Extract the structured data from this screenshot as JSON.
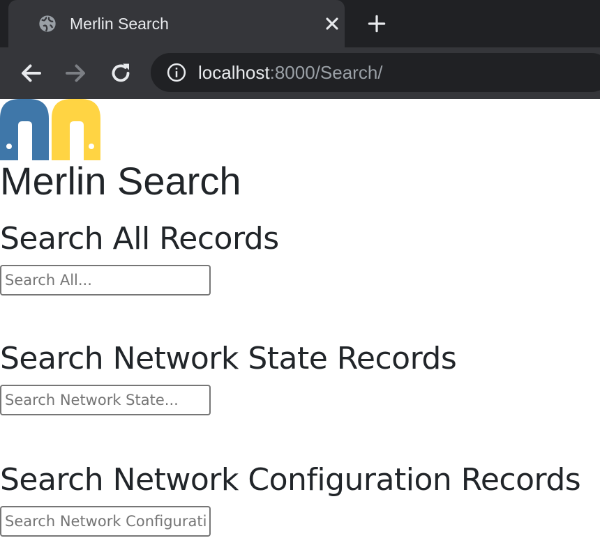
{
  "browser": {
    "tab": {
      "title": "Merlin Search",
      "icon": "globe-icon"
    },
    "new_tab_icon": "plus-icon",
    "address_bar": {
      "host": "localhost",
      "path": ":8000/Search/",
      "info_icon": "info-icon"
    }
  },
  "page": {
    "logo": "merlin-logo",
    "title": "Merlin Search",
    "sections": [
      {
        "heading": "Search All Records",
        "placeholder": "Search All..."
      },
      {
        "heading": "Search Network State Records",
        "placeholder": "Search Network State..."
      },
      {
        "heading": "Search Network Configuration Records",
        "placeholder": "Search Network Configuration..."
      }
    ]
  },
  "colors": {
    "logo_blue": "#3f77a9",
    "logo_yellow": "#ffd443",
    "heading_text": "#212529",
    "chrome_dark": "#202124",
    "chrome_tab": "#35363a"
  }
}
